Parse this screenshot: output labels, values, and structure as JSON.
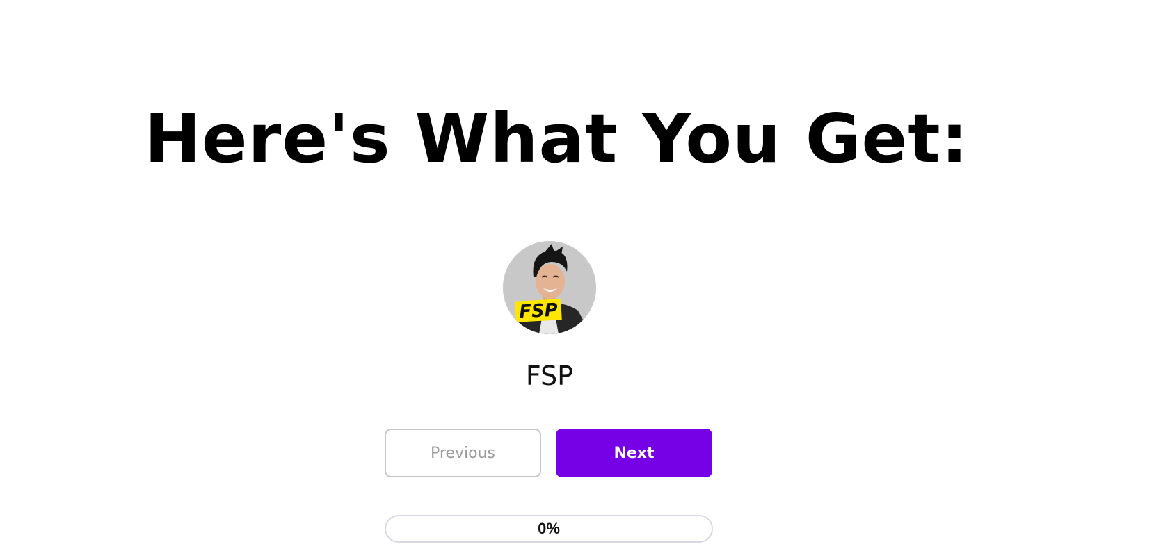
{
  "headline": "Here's What You Get:",
  "profile": {
    "name": "FSP",
    "avatar_badge_text": "FSP"
  },
  "navigation": {
    "previous_label": "Previous",
    "next_label": "Next"
  },
  "progress": {
    "value": 0,
    "label": "0%"
  },
  "colors": {
    "accent": "#7600e6",
    "badge": "#ffe600"
  }
}
